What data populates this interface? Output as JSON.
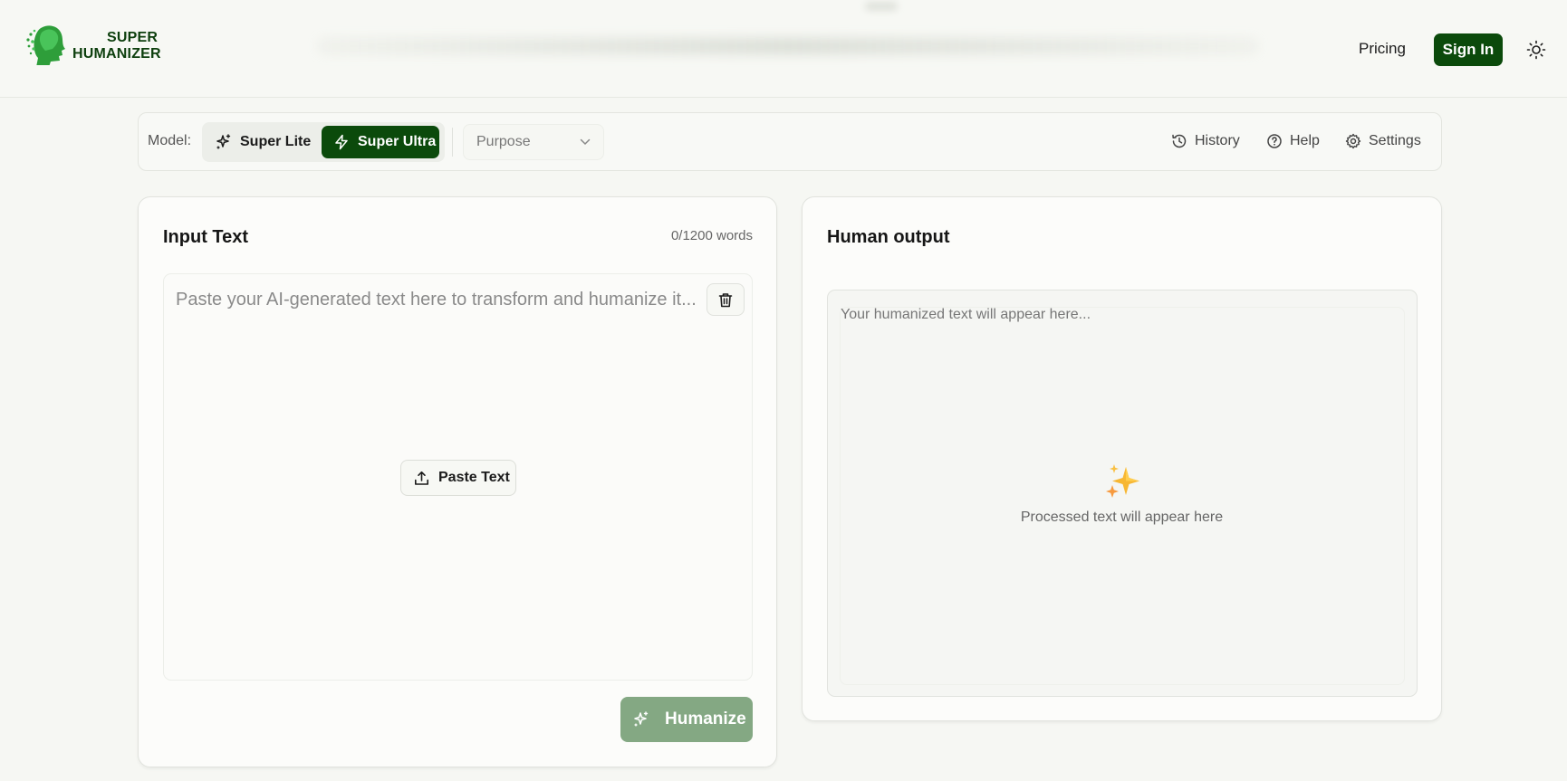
{
  "header": {
    "logo_line1": "SUPER",
    "logo_line2": "HUMANIZER",
    "pricing_label": "Pricing",
    "signin_label": "Sign In",
    "theme_icon": "sun-icon"
  },
  "toolbar": {
    "model_label": "Model:",
    "models": [
      {
        "label": "Super Lite",
        "icon": "sparkles-icon",
        "selected": false
      },
      {
        "label": "Super Ultra",
        "icon": "lightning-icon",
        "selected": true
      }
    ],
    "purpose_label": "Purpose",
    "history_label": "History",
    "help_label": "Help",
    "settings_label": "Settings"
  },
  "input_panel": {
    "title": "Input Text",
    "word_count": "0/1200 words",
    "placeholder": "Paste your AI-generated text here to transform and humanize it...",
    "paste_label": "Paste Text",
    "humanize_label": "Humanize"
  },
  "output_panel": {
    "title": "Human output",
    "placeholder": "Your humanized text will appear here...",
    "empty_message": "Processed text will appear here"
  },
  "colors": {
    "brand_green": "#0b4a0b",
    "humanize_disabled": "#84a883",
    "background": "#f6f7f3"
  }
}
